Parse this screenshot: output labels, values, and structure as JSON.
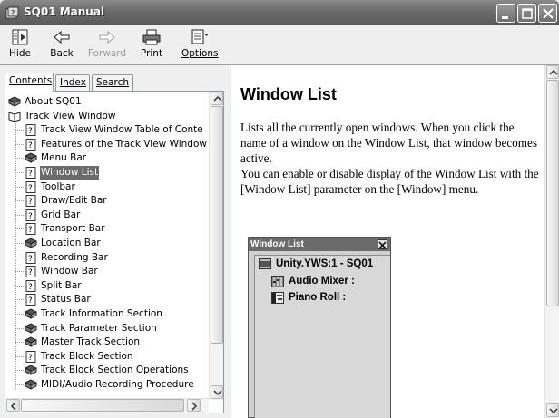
{
  "window": {
    "title": "SQ01 Manual"
  },
  "toolbar": {
    "hide": "Hide",
    "back": "Back",
    "forward": "Forward",
    "print": "Print",
    "options": "Options"
  },
  "tabs": {
    "contents": "Contents",
    "index": "Index",
    "search": "Search"
  },
  "tree": {
    "items": [
      {
        "label": "About SQ01",
        "icon": "book-icon"
      },
      {
        "label": "Track View Window",
        "icon": "open-book-icon"
      },
      {
        "label": "Track View Window Table of Conte",
        "icon": "help-page-icon"
      },
      {
        "label": "Features of the Track View Window",
        "icon": "help-page-icon"
      },
      {
        "label": "Menu Bar",
        "icon": "book-icon"
      },
      {
        "label": "Window List",
        "icon": "help-page-icon",
        "selected": true
      },
      {
        "label": "Toolbar",
        "icon": "help-page-icon"
      },
      {
        "label": "Draw/Edit Bar",
        "icon": "help-page-icon"
      },
      {
        "label": "Grid Bar",
        "icon": "help-page-icon"
      },
      {
        "label": "Transport Bar",
        "icon": "help-page-icon"
      },
      {
        "label": "Location Bar",
        "icon": "book-icon"
      },
      {
        "label": "Recording Bar",
        "icon": "help-page-icon"
      },
      {
        "label": "Window Bar",
        "icon": "help-page-icon"
      },
      {
        "label": "Split Bar",
        "icon": "help-page-icon"
      },
      {
        "label": "Status Bar",
        "icon": "help-page-icon"
      },
      {
        "label": "Track Information Section",
        "icon": "book-icon"
      },
      {
        "label": "Track Parameter Section",
        "icon": "book-icon"
      },
      {
        "label": "Master Track Section",
        "icon": "book-icon"
      },
      {
        "label": "Track Block Section",
        "icon": "help-page-icon"
      },
      {
        "label": "Track Block Section Operations",
        "icon": "book-icon"
      },
      {
        "label": "MIDI/Audio Recording Procedure",
        "icon": "book-icon"
      }
    ]
  },
  "topic": {
    "title": "Window List",
    "paragraph1": "Lists all the currently open windows. When you click the name of a window on the Window List, that window becomes active.",
    "paragraph2": "You can enable or disable display of the Window List with the [Window List] parameter on the [Window] menu."
  },
  "window_list_panel": {
    "title": "Window List",
    "items": [
      {
        "label": "Unity.YWS:1 - SQ01",
        "icon": "song-icon"
      },
      {
        "label": "Audio Mixer :",
        "icon": "mixer-icon"
      },
      {
        "label": "Piano Roll :",
        "icon": "piano-roll-icon"
      }
    ]
  }
}
